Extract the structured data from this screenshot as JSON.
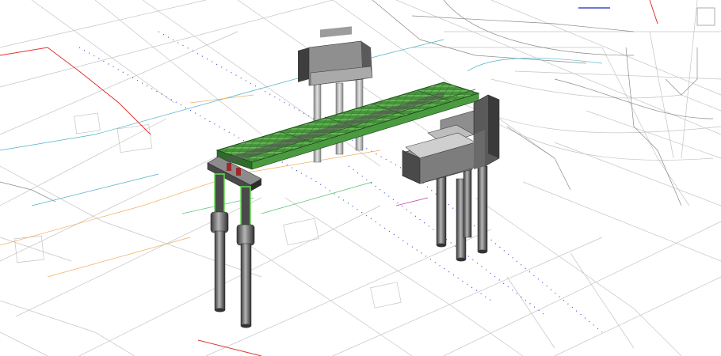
{
  "viewport": {
    "background": "#ffffff",
    "colors": {
      "plan_lines": "#b8b8b8",
      "plan_lines_dark": "#7a7a7a",
      "red_boundary": "#e0322f",
      "blue_axis": "#3a4fd0",
      "teal_line": "#4bb3c8",
      "orange_line": "#f0b060",
      "green_line": "#52c26a",
      "deck_green": "#3f8f3a",
      "deck_green_light": "#6fbf5c",
      "concrete_light": "#c8c8c8",
      "concrete_mid": "#8c8c8c",
      "concrete_dark": "#4a4a4a",
      "highlight_green": "#66dd55"
    }
  }
}
